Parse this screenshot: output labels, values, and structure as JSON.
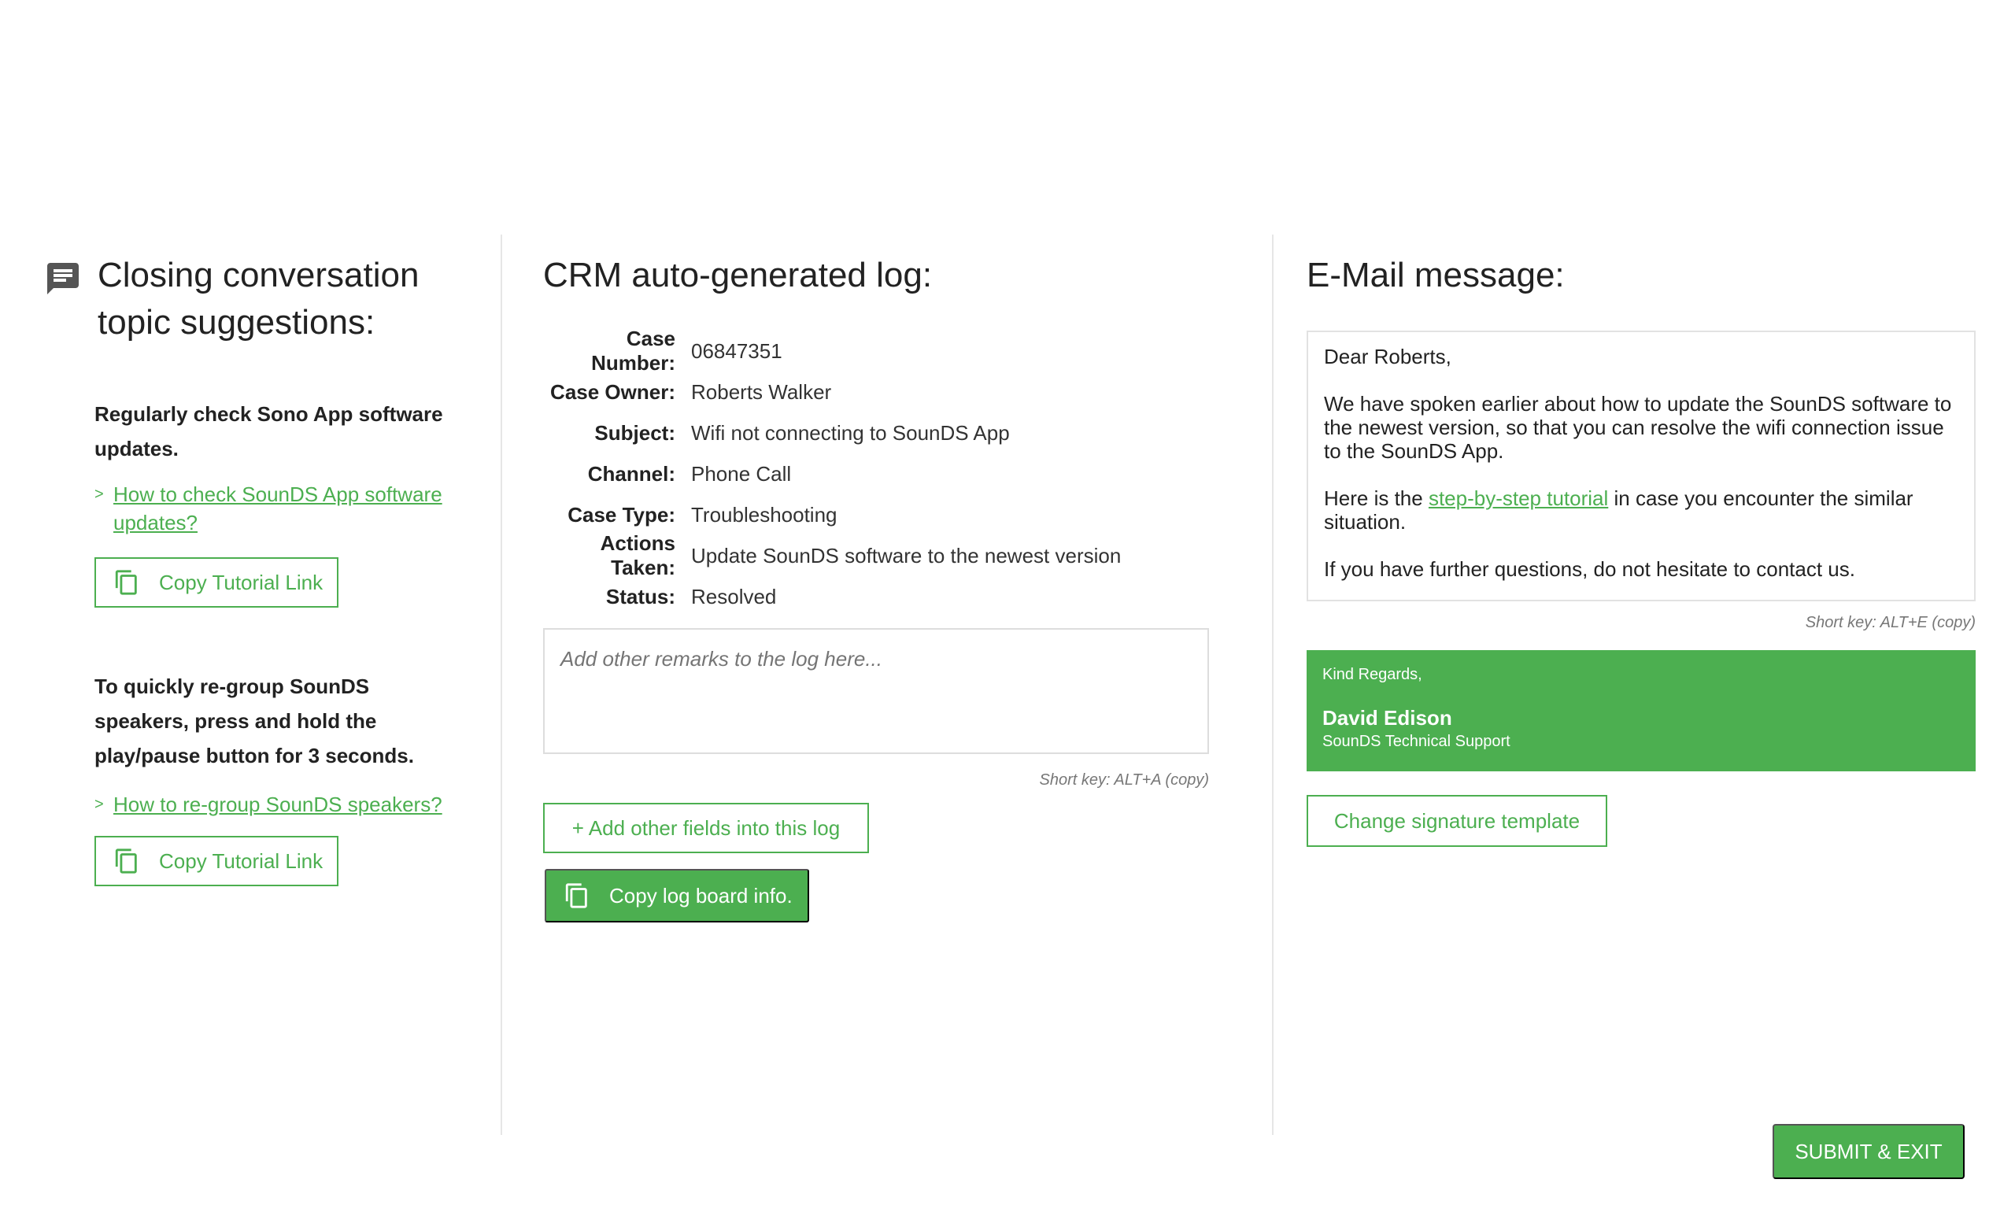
{
  "left": {
    "title": "Closing conversation topic suggestions:",
    "icon": "chat-icon",
    "suggestions": [
      {
        "text": "Regularly check Sono App software updates.",
        "link_chevron": ">",
        "link": "How to check SounDS App software updates?",
        "button": "Copy Tutorial Link"
      },
      {
        "text": "To quickly re-group SounDS speakers, press and hold the play/pause button for 3 seconds.",
        "link_chevron": ">",
        "link": "How to re-group SounDS speakers?",
        "button": "Copy Tutorial Link"
      }
    ]
  },
  "log": {
    "title": "CRM auto-generated log:",
    "rows": [
      {
        "label": "Case Number:",
        "value": "06847351"
      },
      {
        "label": "Case Owner:",
        "value": "Roberts Walker"
      },
      {
        "label": "Subject:",
        "value": "Wifi not connecting to SounDS App"
      },
      {
        "label": "Channel:",
        "value": "Phone Call"
      },
      {
        "label": "Case Type:",
        "value": "Troubleshooting"
      },
      {
        "label": "Actions Taken:",
        "value": "Update SounDS software to the newest version"
      },
      {
        "label": "Status:",
        "value": "Resolved"
      }
    ],
    "remarks_placeholder": "Add other remarks to the log here...",
    "remarks_value": "",
    "shortkey": "Short key: ALT+A (copy)",
    "add_fields_button": "+ Add other fields into this log",
    "copy_button": "Copy log board info."
  },
  "email": {
    "title": "E-Mail message:",
    "greeting": "Dear Roberts,",
    "para1": "We have spoken earlier about how to update the SounDS software to the newest version, so that you can resolve the wifi connection issue to the SounDS App.",
    "para2_before": "Here is the ",
    "para2_link": "step-by-step tutorial",
    "para2_after": " in case you encounter the similar situation.",
    "para3": "If you have further questions, do not hesitate to contact us.",
    "shortkey": "Short key: ALT+E (copy)",
    "signature": {
      "regards": "Kind Regards,",
      "name": "David Edison",
      "role": "SounDS Technical Support"
    },
    "change_signature_button": "Change signature template"
  },
  "submit_button": "SUBMIT & EXIT",
  "colors": {
    "accent": "#4caf50",
    "divider": "#e6e6e6",
    "icon_gray": "#555555"
  }
}
